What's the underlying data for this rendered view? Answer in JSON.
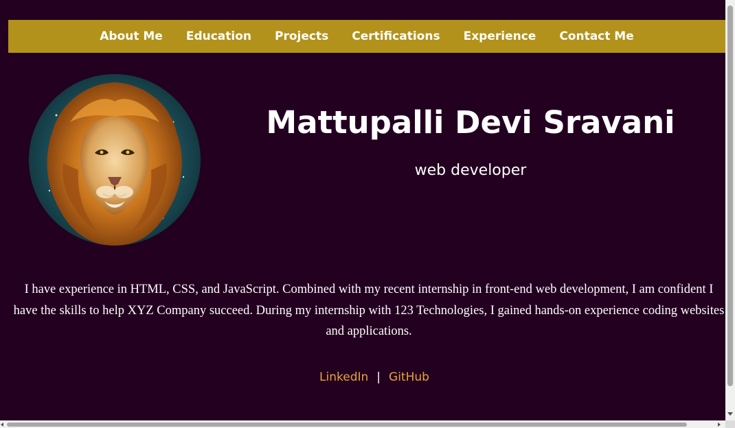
{
  "nav": {
    "items": [
      {
        "label": "About Me"
      },
      {
        "label": "Education"
      },
      {
        "label": "Projects"
      },
      {
        "label": "Certifications"
      },
      {
        "label": "Experience"
      },
      {
        "label": "Contact Me"
      }
    ]
  },
  "profile": {
    "avatar_icon": "lion-avatar",
    "name": "Mattupalli Devi Sravani",
    "role": "web developer"
  },
  "about": {
    "bio": "I have experience in HTML, CSS, and JavaScript. Combined with my recent internship in front-end web development, I am confident I have the skills to help XYZ Company succeed. During my internship with 123 Technologies, I gained hands-on experience coding websites and applications."
  },
  "social": {
    "linkedin_label": "LinkedIn",
    "separator": "|",
    "github_label": "GitHub"
  },
  "colors": {
    "background": "#230020",
    "navbar": "#b2921b",
    "link": "#e8a33c",
    "text": "#ffffff"
  }
}
